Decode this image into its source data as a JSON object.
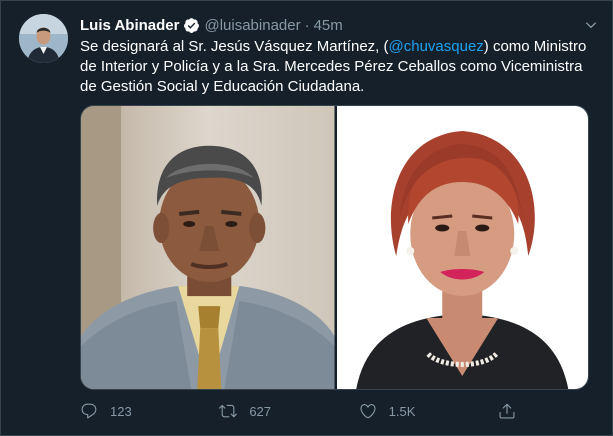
{
  "tweet": {
    "author_name": "Luis Abinader",
    "handle": "@luisabinader",
    "separator": "·",
    "time": "45m",
    "verified": true,
    "text_part1": "Se designará al Sr. Jesús Vásquez Martínez, (",
    "mention": "@chuvasquez",
    "text_part2": ") como Ministro de Interior y Policía y a la Sra. Mercedes Pérez Ceballos como Viceministra de Gestión Social y Educación Ciudadana."
  },
  "actions": {
    "reply_count": "123",
    "retweet_count": "627",
    "like_count": "1.5K"
  },
  "icons": {
    "verified": "verified-badge-icon",
    "more": "chevron-down-icon",
    "reply": "reply-icon",
    "retweet": "retweet-icon",
    "like": "heart-icon",
    "share": "share-icon"
  },
  "colors": {
    "background": "#15202b",
    "text": "#ffffff",
    "secondary_text": "#8899a6",
    "accent": "#1da1f2",
    "border": "#38444d"
  }
}
